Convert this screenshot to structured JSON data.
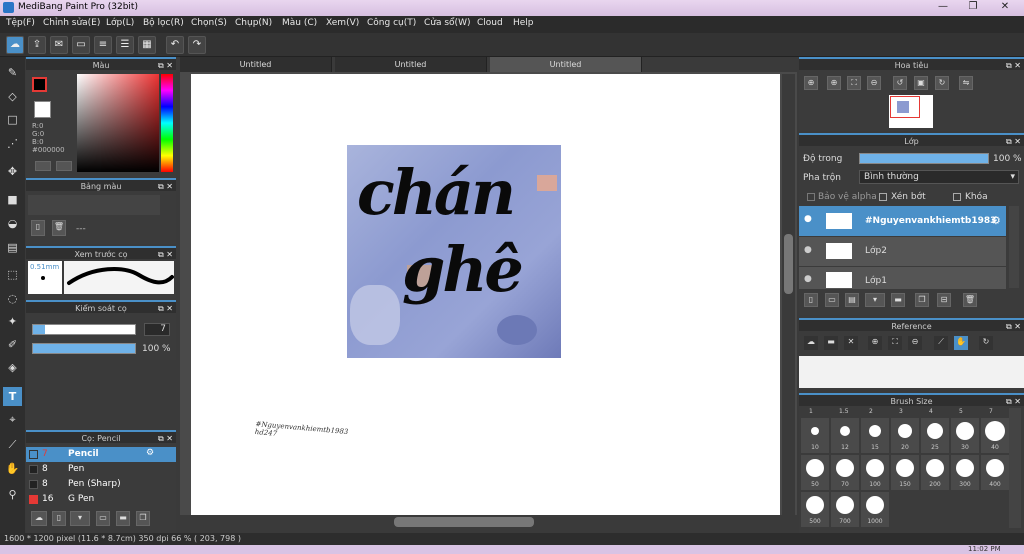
{
  "app": {
    "title": "MediBang Paint Pro (32bit)"
  },
  "menu": [
    "Tệp(F)",
    "Chỉnh sửa(E)",
    "Lớp(L)",
    "Bộ lọc(R)",
    "Chọn(S)",
    "Chụp(N)",
    "Màu (C)",
    "Xem(V)",
    "Công cụ(T)",
    "Cửa sổ(W)",
    "Cloud",
    "Help"
  ],
  "tabs": [
    "Untitled",
    "Untitled",
    "Untitled"
  ],
  "color_panel": {
    "title": "Màu",
    "r": "R:0",
    "g": "G:0",
    "b": "B:0",
    "hex": "#000000"
  },
  "palette_panel": {
    "title": "Bảng màu",
    "value": "---"
  },
  "brush_preview": {
    "title": "Xem trước cọ",
    "size": "0.51mm"
  },
  "brush_control": {
    "title": "Kiểm soát cọ",
    "size": "7",
    "opacity": "100 %"
  },
  "brush_list": {
    "title": "Cọ: Pencil",
    "items": [
      {
        "size": "7",
        "name": "Pencil",
        "color": "#e53935"
      },
      {
        "size": "8",
        "name": "Pen",
        "color": "#222222"
      },
      {
        "size": "8",
        "name": "Pen (Sharp)",
        "color": "#222222"
      },
      {
        "size": "16",
        "name": "G Pen",
        "color": "#e53935"
      }
    ]
  },
  "navigator": {
    "title": "Hoa tiêu"
  },
  "layer_panel": {
    "title": "Lớp",
    "opacity_label": "Độ trong",
    "opacity_value": "100 %",
    "blend_label": "Pha trộn",
    "blend_value": "Bình thường",
    "protect_alpha": "Bảo vệ alpha",
    "clipping": "Xén bớt",
    "lock": "Khóa",
    "layers": [
      "#Nguyenvankhiemtb1983",
      "Lớp2",
      "Lớp1"
    ]
  },
  "reference": {
    "title": "Reference"
  },
  "brush_size": {
    "title": "Brush Size",
    "labels_top": [
      "1",
      "1.5",
      "2",
      "3",
      "4",
      "5",
      "7"
    ],
    "rows": [
      [
        "10",
        "12",
        "15",
        "20",
        "25",
        "30",
        "40"
      ],
      [
        "50",
        "70",
        "100",
        "150",
        "200",
        "300",
        "400"
      ],
      [
        "500",
        "700",
        "1000"
      ]
    ]
  },
  "canvas_text": {
    "line1": "chán",
    "line2": "ghê",
    "watermark1": "#Nguyenvankhiemtb1983",
    "watermark2": "hd247"
  },
  "status": {
    "text": "1600 * 1200 pixel   (11.6 * 8.7cm)   350 dpi   66 %   ( 203, 798 )"
  },
  "taskbar": {
    "clock": "11:02 PM"
  }
}
